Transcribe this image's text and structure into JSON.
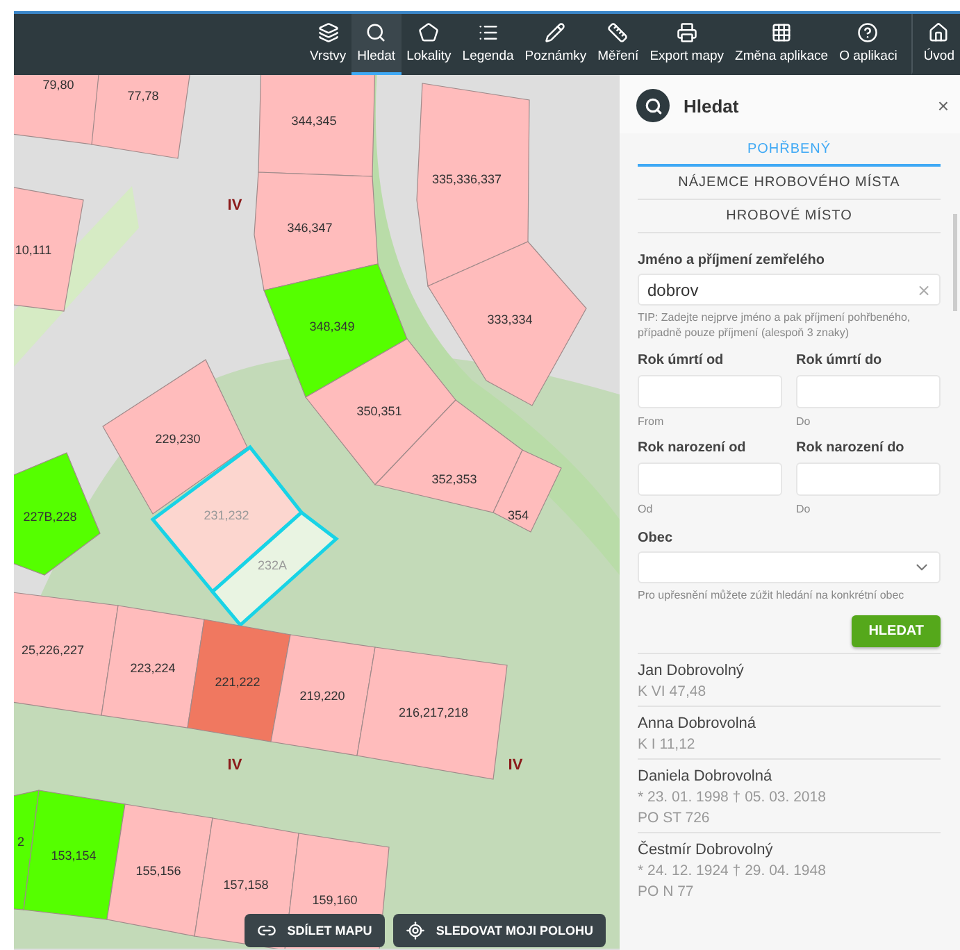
{
  "toolbar": {
    "items": [
      {
        "label": "Vrstvy",
        "selected": false
      },
      {
        "label": "Hledat",
        "selected": true
      },
      {
        "label": "Lokality",
        "selected": false
      },
      {
        "label": "Legenda",
        "selected": false
      },
      {
        "label": "Poznámky",
        "selected": false
      },
      {
        "label": "Měření",
        "selected": false
      },
      {
        "label": "Export mapy",
        "selected": false
      },
      {
        "label": "Změna aplikace",
        "selected": false
      },
      {
        "label": "O aplikaci",
        "selected": false
      },
      {
        "label": "Úvod",
        "selected": false
      }
    ]
  },
  "map": {
    "plots": [
      {
        "label": "79,80",
        "color": "#ffbcbc",
        "selected": false
      },
      {
        "label": "77,78",
        "color": "#ffbcbc",
        "selected": false
      },
      {
        "label": "344,345",
        "color": "#ffbcbc",
        "selected": false
      },
      {
        "label": "346,347",
        "color": "#ffbcbc",
        "selected": false
      },
      {
        "label": "348,349",
        "color": "#55ff00",
        "selected": false
      },
      {
        "label": "335,336,337",
        "color": "#ffbcbc",
        "selected": false
      },
      {
        "label": "333,334",
        "color": "#ffbcbc",
        "selected": false
      },
      {
        "label": "350,351",
        "color": "#ffbcbc",
        "selected": false
      },
      {
        "label": "352,353",
        "color": "#ffbcbc",
        "selected": false
      },
      {
        "label": "354",
        "color": "#ffbcbc",
        "selected": false
      },
      {
        "label": "10,111",
        "color": "#ffbcbc",
        "selected": false
      },
      {
        "label": "229,230",
        "color": "#ffbcbc",
        "selected": false
      },
      {
        "label": "227B,228",
        "color": "#55ff00",
        "selected": false
      },
      {
        "label": "231,232",
        "color": "#fcd6cf",
        "selected": true
      },
      {
        "label": "232A",
        "color": "#e9f4e2",
        "selected": true
      },
      {
        "label": "25,226,227",
        "color": "#ffbcbc",
        "selected": false
      },
      {
        "label": "223,224",
        "color": "#ffbcbc",
        "selected": false
      },
      {
        "label": "221,222",
        "color": "#f07860",
        "selected": false
      },
      {
        "label": "219,220",
        "color": "#ffbcbc",
        "selected": false
      },
      {
        "label": "216,217,218",
        "color": "#ffbcbc",
        "selected": false
      },
      {
        "label": "2",
        "color": "#55ff00",
        "selected": false
      },
      {
        "label": "153,154",
        "color": "#55ff00",
        "selected": false
      },
      {
        "label": "155,156",
        "color": "#ffbcbc",
        "selected": false
      },
      {
        "label": "157,158",
        "color": "#ffbcbc",
        "selected": false
      },
      {
        "label": "159,160",
        "color": "#ffbcbc",
        "selected": false
      }
    ],
    "section_labels": [
      "IV",
      "IV",
      "IV"
    ],
    "buttons": [
      "SDÍLET MAPU",
      "SLEDOVAT MOJI POLOHU"
    ]
  },
  "panel": {
    "title": "Hledat",
    "close": "×",
    "tabs": [
      {
        "label": "POHŘBENÝ",
        "selected": true
      },
      {
        "label": "NÁJEMCE HROBOVÉHO MÍSTA",
        "selected": false
      },
      {
        "label": "HROBOVÉ MÍSTO",
        "selected": false
      }
    ],
    "name_field": {
      "label": "Jméno a příjmení zemřelého",
      "value": "dobrov",
      "clear": "×",
      "tip": "TIP: Zadejte nejprve jméno a pak příjmení pohřbeného, případně pouze příjmení (alespoň 3 znaky)"
    },
    "year_fields": [
      {
        "label": "Rok úmrtí od",
        "hint": "From"
      },
      {
        "label": "Rok úmrtí do",
        "hint": "Do"
      },
      {
        "label": "Rok narození od",
        "hint": "Od"
      },
      {
        "label": "Rok narození do",
        "hint": "Do"
      }
    ],
    "municipality": {
      "label": "Obec",
      "hint": "Pro upřesnění můžete zúžit hledání na konkrétní obec"
    },
    "search_button": "HLEDAT",
    "results": [
      {
        "name": "Jan Dobrovolný",
        "lines": [
          "K VI 47,48"
        ]
      },
      {
        "name": "Anna Dobrovolná",
        "lines": [
          "K I 11,12"
        ]
      },
      {
        "name": "Daniela Dobrovolná",
        "lines": [
          "* 23. 01. 1998 † 05. 03. 2018",
          "PO ST 726"
        ]
      },
      {
        "name": "Čestmír Dobrovolný",
        "lines": [
          "* 24. 12. 1924 † 29. 04. 1948",
          "PO N 77"
        ]
      }
    ]
  }
}
